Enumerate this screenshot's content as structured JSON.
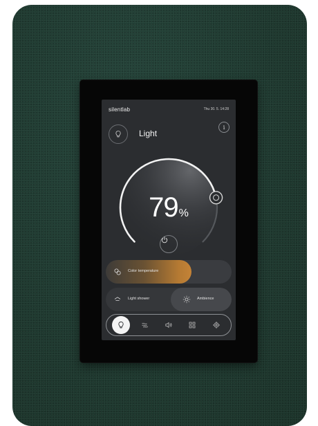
{
  "device": {
    "brand": "silentlab",
    "datetime": "Thu 30. 5. 14:28"
  },
  "panel": {
    "title": "Light",
    "info_symbol": "i",
    "icons": {
      "mode": "bulb-icon",
      "info": "info-icon",
      "power": "power-icon"
    }
  },
  "dial": {
    "value": "79",
    "unit": "%",
    "level": 0.79
  },
  "controls": {
    "color_temperature": {
      "label": "Color temperature",
      "icon": "color-temperature-icon",
      "level": 0.68
    },
    "scenes": [
      {
        "label": "Light shower",
        "icon": "shower-icon",
        "selected": false
      },
      {
        "label": "Ambience",
        "icon": "sun-icon",
        "selected": true
      }
    ]
  },
  "nav": {
    "items": [
      {
        "icon": "bulb-icon",
        "active": true
      },
      {
        "icon": "fan-icon",
        "active": false
      },
      {
        "icon": "speaker-icon",
        "active": false
      },
      {
        "icon": "grid-icon",
        "active": false
      },
      {
        "icon": "gear-icon",
        "active": false
      }
    ]
  },
  "colors": {
    "screen": "#2b2d30",
    "accent_warm": "#c48337",
    "felt": "#1f3b30"
  }
}
